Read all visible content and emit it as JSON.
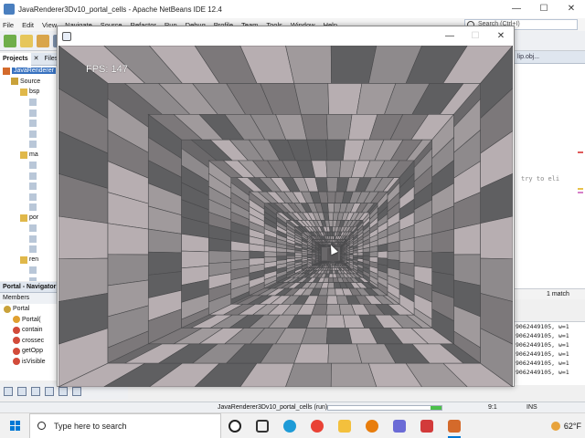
{
  "ide": {
    "window_title": "JavaRenderer3Dv10_portal_cells - Apache NetBeans IDE 12.4",
    "window_buttons": [
      "—",
      "☐",
      "✕"
    ],
    "menu": [
      "File",
      "Edit",
      "View",
      "Navigate",
      "Source",
      "Refactor",
      "Run",
      "Debug",
      "Profile",
      "Team",
      "Tools",
      "Window",
      "Help"
    ],
    "search_placeholder": "Search (Ctrl+I)",
    "projects_tabs": [
      "Projects",
      "✕",
      "Files"
    ],
    "tree": [
      {
        "label": "JavaRenderer",
        "selected": true,
        "icon_color": "#d46a2b"
      },
      {
        "label": "Source",
        "selected": false,
        "icon_color": "#c9a23a"
      },
      {
        "label": "bsp",
        "selected": false,
        "icon_color": "#e0b84a"
      },
      {
        "label": "",
        "selected": false,
        "icon_color": "#b9c7d8"
      },
      {
        "label": "",
        "selected": false,
        "icon_color": "#b9c7d8"
      },
      {
        "label": "",
        "selected": false,
        "icon_color": "#b9c7d8"
      },
      {
        "label": "",
        "selected": false,
        "icon_color": "#b9c7d8"
      },
      {
        "label": "",
        "selected": false,
        "icon_color": "#b9c7d8"
      },
      {
        "label": "ma",
        "selected": false,
        "icon_color": "#e0b84a"
      },
      {
        "label": "",
        "selected": false,
        "icon_color": "#b9c7d8"
      },
      {
        "label": "",
        "selected": false,
        "icon_color": "#b9c7d8"
      },
      {
        "label": "",
        "selected": false,
        "icon_color": "#b9c7d8"
      },
      {
        "label": "",
        "selected": false,
        "icon_color": "#b9c7d8"
      },
      {
        "label": "",
        "selected": false,
        "icon_color": "#b9c7d8"
      },
      {
        "label": "por",
        "selected": false,
        "icon_color": "#e0b84a"
      },
      {
        "label": "",
        "selected": false,
        "icon_color": "#b9c7d8"
      },
      {
        "label": "",
        "selected": false,
        "icon_color": "#b9c7d8"
      },
      {
        "label": "",
        "selected": false,
        "icon_color": "#b9c7d8"
      },
      {
        "label": "ren",
        "selected": false,
        "icon_color": "#e0b84a"
      },
      {
        "label": "",
        "selected": false,
        "icon_color": "#b9c7d8"
      },
      {
        "label": "",
        "selected": false,
        "icon_color": "#b9c7d8"
      }
    ],
    "navigator_title": "Portal - Navigator",
    "navigator_members": "Members",
    "navigator_items": [
      {
        "label": "Portal",
        "icon_color": "#c9a23a"
      },
      {
        "label": "Portal(",
        "icon_color": "#e0a030"
      },
      {
        "label": "contain",
        "icon_color": "#d24b3a"
      },
      {
        "label": "crossec",
        "icon_color": "#d24b3a"
      },
      {
        "label": "getOpp",
        "icon_color": "#d24b3a"
      },
      {
        "label": "isVisible",
        "icon_color": "#d24b3a"
      }
    ],
    "editor_tab_text": "lip.obj...",
    "editor_code_snippet": "try to eli",
    "find_status": "1 match",
    "output_lines": [
      "9062449105, w=1",
      "9062449105, w=1",
      "9062449105, w=1",
      "9062449105, w=1",
      "9062449105, w=1",
      "9062449105, w=1"
    ],
    "status_run": "JavaRenderer3Dv10_portal_cells (run)",
    "status_progress": 0.1,
    "status_position": "9:1",
    "status_mode": "INS"
  },
  "renderer": {
    "window_buttons": [
      "—",
      "☐",
      "✕"
    ],
    "fps_label": "FPS: 147"
  },
  "taskbar": {
    "search_placeholder": "Type here to search",
    "apps": [
      {
        "name": "cortana-circle",
        "color": "#ffffff"
      },
      {
        "name": "task-view",
        "color": "#333333"
      },
      {
        "name": "edge",
        "color": "#1e9bd7"
      },
      {
        "name": "chrome",
        "color": "#e94235"
      },
      {
        "name": "file-explorer",
        "color": "#f3c03d"
      },
      {
        "name": "blender",
        "color": "#e87d0d"
      },
      {
        "name": "app-hex",
        "color": "#6b6bd6"
      },
      {
        "name": "app-red",
        "color": "#d23a3a"
      },
      {
        "name": "java-running",
        "color": "#d46a2b"
      }
    ],
    "temperature": "62°F"
  },
  "colors": {
    "accent": "#0078d4",
    "brick_dark": "#5f5f61",
    "brick_mid": "#8e8a8c",
    "brick_light": "#b7aeb1"
  }
}
